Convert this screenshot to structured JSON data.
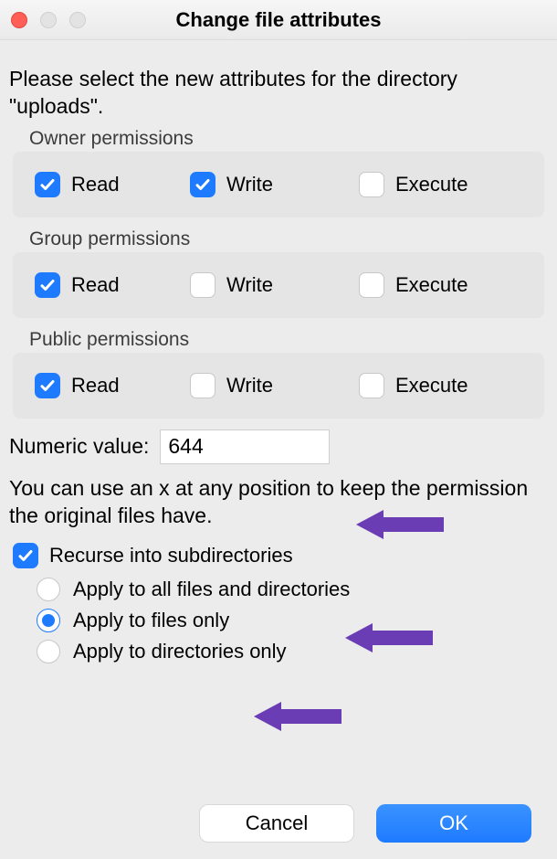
{
  "title": "Change file attributes",
  "intro": "Please select the new attributes for the directory \"uploads\".",
  "sections": {
    "owner": {
      "label": "Owner permissions",
      "read": true,
      "write": true,
      "execute": false
    },
    "group": {
      "label": "Group permissions",
      "read": true,
      "write": false,
      "execute": false
    },
    "public": {
      "label": "Public permissions",
      "read": true,
      "write": false,
      "execute": false
    }
  },
  "perm_labels": {
    "read": "Read",
    "write": "Write",
    "execute": "Execute"
  },
  "numeric": {
    "label": "Numeric value:",
    "value": "644"
  },
  "hint": "You can use an x at any position to keep the permission the original files have.",
  "recurse": {
    "label": "Recurse into subdirectories",
    "checked": true
  },
  "apply": {
    "all": {
      "label": "Apply to all files and directories",
      "selected": false
    },
    "files": {
      "label": "Apply to files only",
      "selected": true
    },
    "dirs": {
      "label": "Apply to directories only",
      "selected": false
    }
  },
  "buttons": {
    "cancel": "Cancel",
    "ok": "OK"
  },
  "colors": {
    "accent": "#1e7bff",
    "arrow": "#6a3db5"
  }
}
